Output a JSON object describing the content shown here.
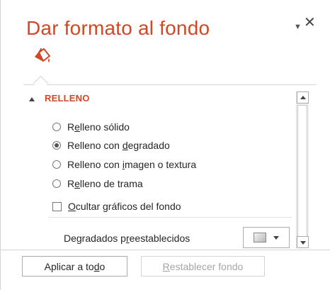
{
  "pane": {
    "title": "Dar formato al fondo",
    "options_glyph": "▼",
    "close_glyph": "✕",
    "tab_icon": "paint-bucket-icon"
  },
  "fill_section": {
    "header": "RELLENO",
    "options": [
      {
        "pre": "R",
        "u": "e",
        "post": "lleno sólido",
        "selected": false
      },
      {
        "pre": "Relleno con ",
        "u": "d",
        "post": "egradado",
        "selected": true
      },
      {
        "pre": "Relleno con ",
        "u": "i",
        "post": "magen o textura",
        "selected": false
      },
      {
        "pre": "R",
        "u": "e",
        "post": "lleno de trama",
        "selected": false
      }
    ],
    "hide_graphics": {
      "pre": "",
      "u": "O",
      "post": "cultar gráficos del fondo",
      "checked": false
    },
    "preset_gradients": {
      "pre": "Degradados p",
      "u": "r",
      "post": "eestablecidos"
    }
  },
  "footer": {
    "apply_all": {
      "pre": "Aplicar a to",
      "u": "d",
      "post": "o"
    },
    "reset": {
      "pre": "",
      "u": "R",
      "post": "establecer fondo",
      "enabled": false
    }
  },
  "colors": {
    "accent": "#d24726"
  }
}
